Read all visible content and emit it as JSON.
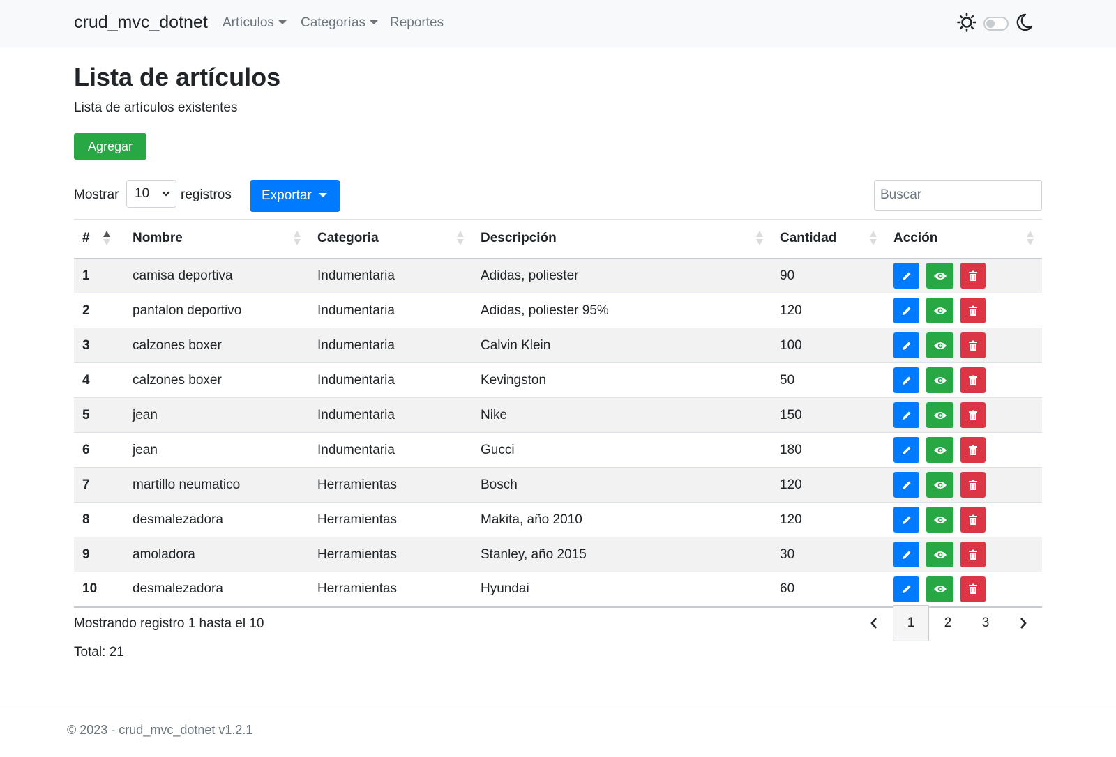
{
  "nav": {
    "brand": "crud_mvc_dotnet",
    "items": [
      "Artículos",
      "Categorías",
      "Reportes"
    ]
  },
  "page": {
    "title": "Lista de artículos",
    "subtitle": "Lista de artículos existentes",
    "add_label": "Agregar"
  },
  "controls": {
    "show_label": "Mostrar",
    "page_size": "10",
    "records_label": "registros",
    "export_label": "Exportar",
    "search_placeholder": "Buscar"
  },
  "table": {
    "headers": [
      "#",
      "Nombre",
      "Categoria",
      "Descripción",
      "Cantidad",
      "Acción"
    ],
    "rows": [
      {
        "id": "1",
        "nombre": "camisa deportiva",
        "categoria": "Indumentaria",
        "descripcion": "Adidas, poliester",
        "cantidad": "90"
      },
      {
        "id": "2",
        "nombre": "pantalon deportivo",
        "categoria": "Indumentaria",
        "descripcion": "Adidas, poliester 95%",
        "cantidad": "120"
      },
      {
        "id": "3",
        "nombre": "calzones boxer",
        "categoria": "Indumentaria",
        "descripcion": "Calvin Klein",
        "cantidad": "100"
      },
      {
        "id": "4",
        "nombre": "calzones boxer",
        "categoria": "Indumentaria",
        "descripcion": "Kevingston",
        "cantidad": "50"
      },
      {
        "id": "5",
        "nombre": "jean",
        "categoria": "Indumentaria",
        "descripcion": "Nike",
        "cantidad": "150"
      },
      {
        "id": "6",
        "nombre": "jean",
        "categoria": "Indumentaria",
        "descripcion": "Gucci",
        "cantidad": "180"
      },
      {
        "id": "7",
        "nombre": "martillo neumatico",
        "categoria": "Herramientas",
        "descripcion": "Bosch",
        "cantidad": "120"
      },
      {
        "id": "8",
        "nombre": "desmalezadora",
        "categoria": "Herramientas",
        "descripcion": "Makita, año 2010",
        "cantidad": "120"
      },
      {
        "id": "9",
        "nombre": "amoladora",
        "categoria": "Herramientas",
        "descripcion": "Stanley, año 2015",
        "cantidad": "30"
      },
      {
        "id": "10",
        "nombre": "desmalezadora",
        "categoria": "Herramientas",
        "descripcion": "Hyundai",
        "cantidad": "60"
      }
    ]
  },
  "pagination": {
    "info": "Mostrando registro 1 hasta el 10",
    "total": "Total: 21",
    "pages": [
      "1",
      "2",
      "3"
    ],
    "current": "1"
  },
  "footer": {
    "copyright": "© 2023 - crud_mvc_dotnet v1.2.1"
  },
  "colors": {
    "primary": "#007bff",
    "success": "#28a745",
    "danger": "#dc3545"
  },
  "icons": {
    "edit": "pencil-icon",
    "view": "eye-icon",
    "delete": "trash-icon",
    "theme_light": "sun-icon",
    "theme_dark": "moon-icon"
  }
}
